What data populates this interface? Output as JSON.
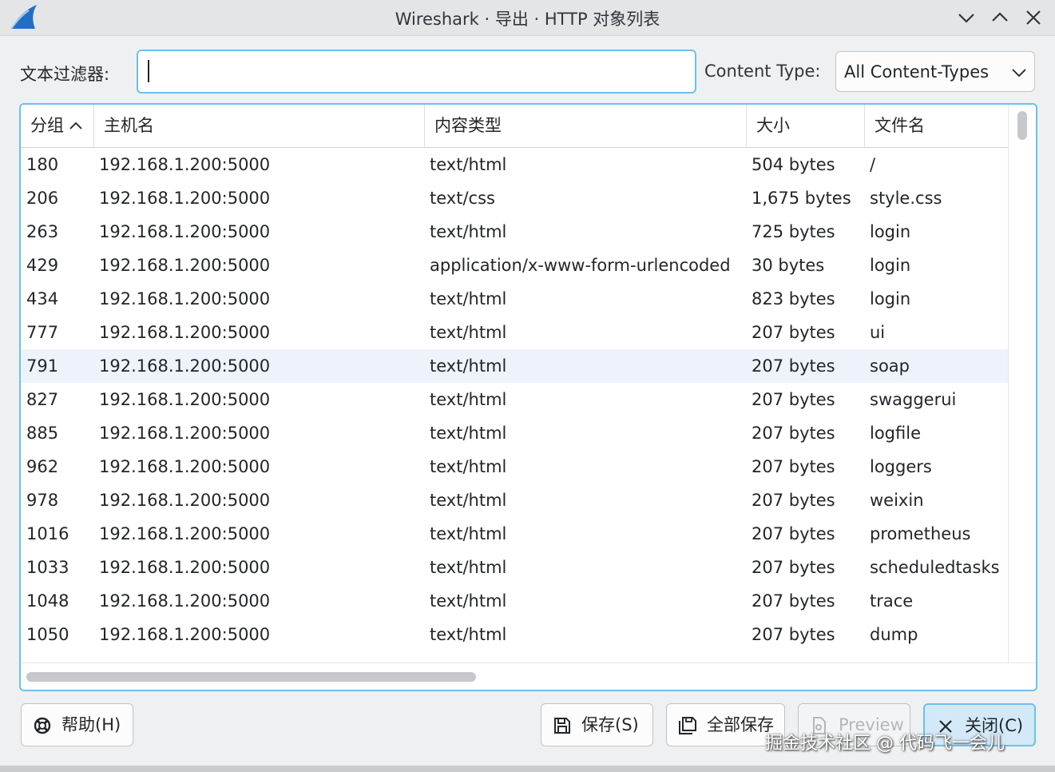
{
  "window": {
    "title": "Wireshark · 导出 · HTTP 对象列表",
    "app_icon": "wireshark-fin-icon"
  },
  "filter": {
    "label": "文本过滤器:",
    "value": ""
  },
  "content_type": {
    "label": "Content Type:",
    "selected": "All Content-Types"
  },
  "table": {
    "columns": [
      "分组",
      "主机名",
      "内容类型",
      "大小",
      "文件名"
    ],
    "sort": {
      "column": "分组",
      "direction": "ascending"
    },
    "rows": [
      [
        "180",
        "192.168.1.200:5000",
        "text/html",
        "504 bytes",
        "/"
      ],
      [
        "206",
        "192.168.1.200:5000",
        "text/css",
        "1,675 bytes",
        "style.css"
      ],
      [
        "263",
        "192.168.1.200:5000",
        "text/html",
        "725 bytes",
        "login"
      ],
      [
        "429",
        "192.168.1.200:5000",
        "application/x-www-form-urlencoded",
        "30 bytes",
        "login"
      ],
      [
        "434",
        "192.168.1.200:5000",
        "text/html",
        "823 bytes",
        "login"
      ],
      [
        "777",
        "192.168.1.200:5000",
        "text/html",
        "207 bytes",
        "ui"
      ],
      [
        "791",
        "192.168.1.200:5000",
        "text/html",
        "207 bytes",
        "soap"
      ],
      [
        "827",
        "192.168.1.200:5000",
        "text/html",
        "207 bytes",
        "swaggerui"
      ],
      [
        "885",
        "192.168.1.200:5000",
        "text/html",
        "207 bytes",
        "logfile"
      ],
      [
        "962",
        "192.168.1.200:5000",
        "text/html",
        "207 bytes",
        "loggers"
      ],
      [
        "978",
        "192.168.1.200:5000",
        "text/html",
        "207 bytes",
        "weixin"
      ],
      [
        "1016",
        "192.168.1.200:5000",
        "text/html",
        "207 bytes",
        "prometheus"
      ],
      [
        "1033",
        "192.168.1.200:5000",
        "text/html",
        "207 bytes",
        "scheduledtasks"
      ],
      [
        "1048",
        "192.168.1.200:5000",
        "text/html",
        "207 bytes",
        "trace"
      ],
      [
        "1050",
        "192.168.1.200:5000",
        "text/html",
        "207 bytes",
        "dump"
      ]
    ]
  },
  "buttons": {
    "help": "帮助(H)",
    "save": "保存(S)",
    "save_all": "全部保存",
    "preview": "Preview",
    "close": "关闭(C)"
  },
  "watermark": "掘金技术社区 @ 代码飞一会儿",
  "colors": {
    "accent": "#6cc0ec",
    "highlight_row": "#eef3fb",
    "primary_button": "#d3e9f8"
  }
}
